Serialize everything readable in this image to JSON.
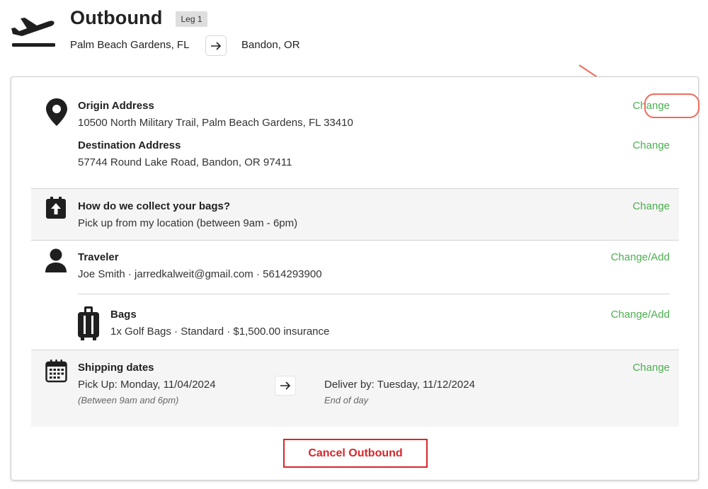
{
  "header": {
    "title": "Outbound",
    "leg_badge": "Leg 1",
    "origin_city": "Palm Beach Gardens, FL",
    "destination_city": "Bandon, OR"
  },
  "addresses": {
    "origin_label": "Origin Address",
    "origin_value": "10500 North Military Trail, Palm Beach Gardens, FL 33410",
    "origin_change": "Change",
    "destination_label": "Destination Address",
    "destination_value": "57744 Round Lake Road, Bandon, OR 97411",
    "destination_change": "Change"
  },
  "collection": {
    "label": "How do we collect your bags?",
    "value": "Pick up from my location (between 9am - 6pm)",
    "change": "Change"
  },
  "traveler": {
    "label": "Traveler",
    "value": "Joe Smith · jarredkalweit@gmail.com · 5614293900",
    "change": "Change/Add"
  },
  "bags": {
    "label": "Bags",
    "value": "1x Golf Bags · Standard · $1,500.00 insurance",
    "change": "Change/Add"
  },
  "shipping": {
    "label": "Shipping dates",
    "pickup": "Pick Up: Monday, 11/04/2024",
    "pickup_note": "(Between 9am and 6pm)",
    "deliver": "Deliver by: Tuesday, 11/12/2024",
    "deliver_note": "End of day",
    "change": "Change"
  },
  "actions": {
    "cancel_label": "Cancel Outbound"
  },
  "colors": {
    "accent_green": "#4caf50",
    "cancel_red": "#d9262b",
    "annotation": "#f26b5b"
  },
  "icons": [
    "plane-departure-icon",
    "arrow-right-icon",
    "map-pin-icon",
    "bag-pickup-icon",
    "person-icon",
    "luggage-icon",
    "calendar-icon"
  ]
}
